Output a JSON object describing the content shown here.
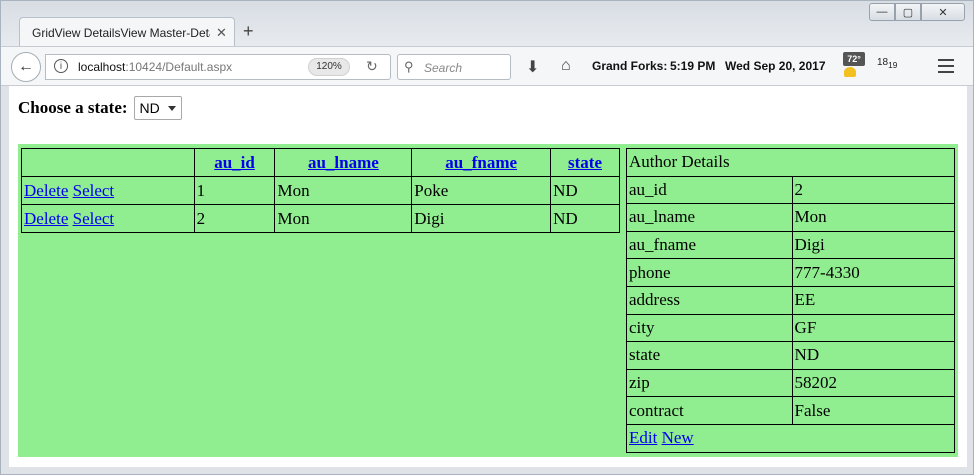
{
  "browser": {
    "tab_title": "GridView DetailsView Master-Deta",
    "url_host": "localhost",
    "url_path": ":10424/Default.aspx",
    "zoom": "120%",
    "search_placeholder": "Search",
    "location": "Grand Forks:",
    "time": "5:19 PM",
    "date": "Wed Sep 20, 2017",
    "temperature": "72°",
    "days_top": "18",
    "days_bottom": "19"
  },
  "page": {
    "state_label": "Choose a state:",
    "state_value": "ND",
    "grid": {
      "headers": [
        "",
        "au_id",
        "au_lname",
        "au_fname",
        "state"
      ],
      "delete_label": "Delete",
      "select_label": "Select",
      "rows": [
        {
          "au_id": "1",
          "au_lname": "Mon",
          "au_fname": "Poke",
          "state": "ND"
        },
        {
          "au_id": "2",
          "au_lname": "Mon",
          "au_fname": "Digi",
          "state": "ND"
        }
      ]
    },
    "details": {
      "title": "Author Details",
      "fields": [
        {
          "label": "au_id",
          "value": "2"
        },
        {
          "label": "au_lname",
          "value": "Mon"
        },
        {
          "label": "au_fname",
          "value": "Digi"
        },
        {
          "label": "phone",
          "value": "777-4330"
        },
        {
          "label": "address",
          "value": "EE"
        },
        {
          "label": "city",
          "value": "GF"
        },
        {
          "label": "state",
          "value": "ND"
        },
        {
          "label": "zip",
          "value": "58202"
        },
        {
          "label": "contract",
          "value": "False"
        }
      ],
      "edit_label": "Edit",
      "new_label": "New"
    },
    "colors": {
      "grid_background": "#90ee90",
      "link": "#0000ee"
    }
  }
}
